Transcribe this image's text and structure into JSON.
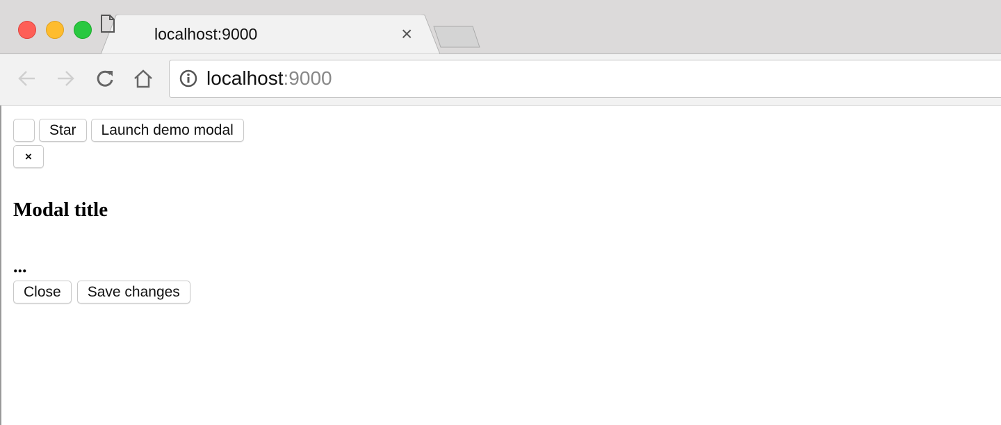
{
  "window": {
    "traffic_lights": {
      "close": "#fe5f57",
      "minimize": "#febc2e",
      "zoom": "#29c840"
    }
  },
  "tab": {
    "title": "localhost:9000",
    "close_glyph": "×",
    "icon": "document-icon"
  },
  "address_bar": {
    "host": "localhost",
    "port": ":9000"
  },
  "page": {
    "star_label": "Star",
    "launch_label": "Launch demo modal",
    "dismiss_label": "×",
    "modal_title": "Modal title",
    "modal_body": "...",
    "close_label": "Close",
    "save_label": "Save changes"
  }
}
